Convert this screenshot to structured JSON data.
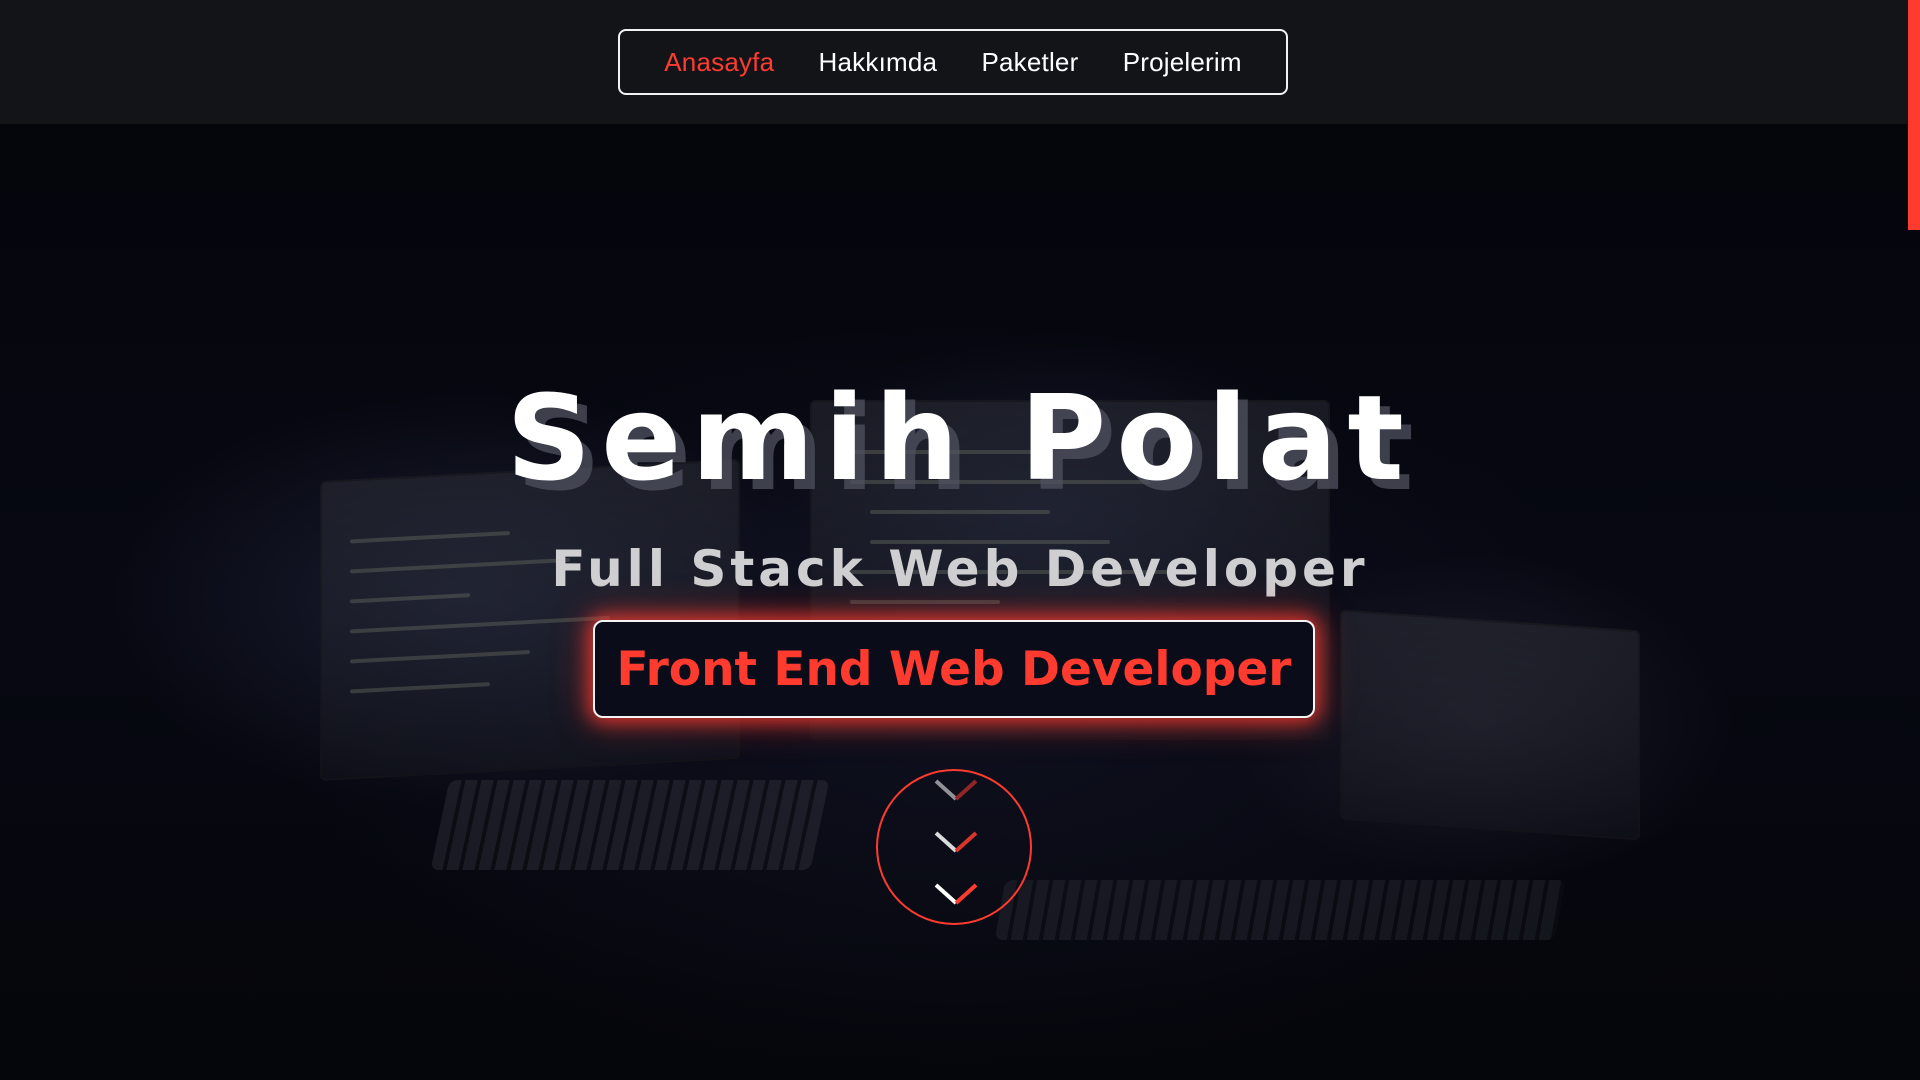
{
  "nav": {
    "items": [
      {
        "label": "Anasayfa",
        "active": true
      },
      {
        "label": "Hakkımda",
        "active": false
      },
      {
        "label": "Paketler",
        "active": false
      },
      {
        "label": "Projelerim",
        "active": false
      }
    ]
  },
  "hero": {
    "name": "Semih Polat",
    "role": "Full Stack Web Developer",
    "typing_text": "Front End Web Developer"
  },
  "icons": {
    "scroll_down": "chevrons-down-icon"
  },
  "colors": {
    "accent": "#ff3b2f",
    "navbar_bg": "#131418",
    "page_bg": "#05060b",
    "text_primary": "#ffffff",
    "text_secondary": "#cfcfd2"
  }
}
